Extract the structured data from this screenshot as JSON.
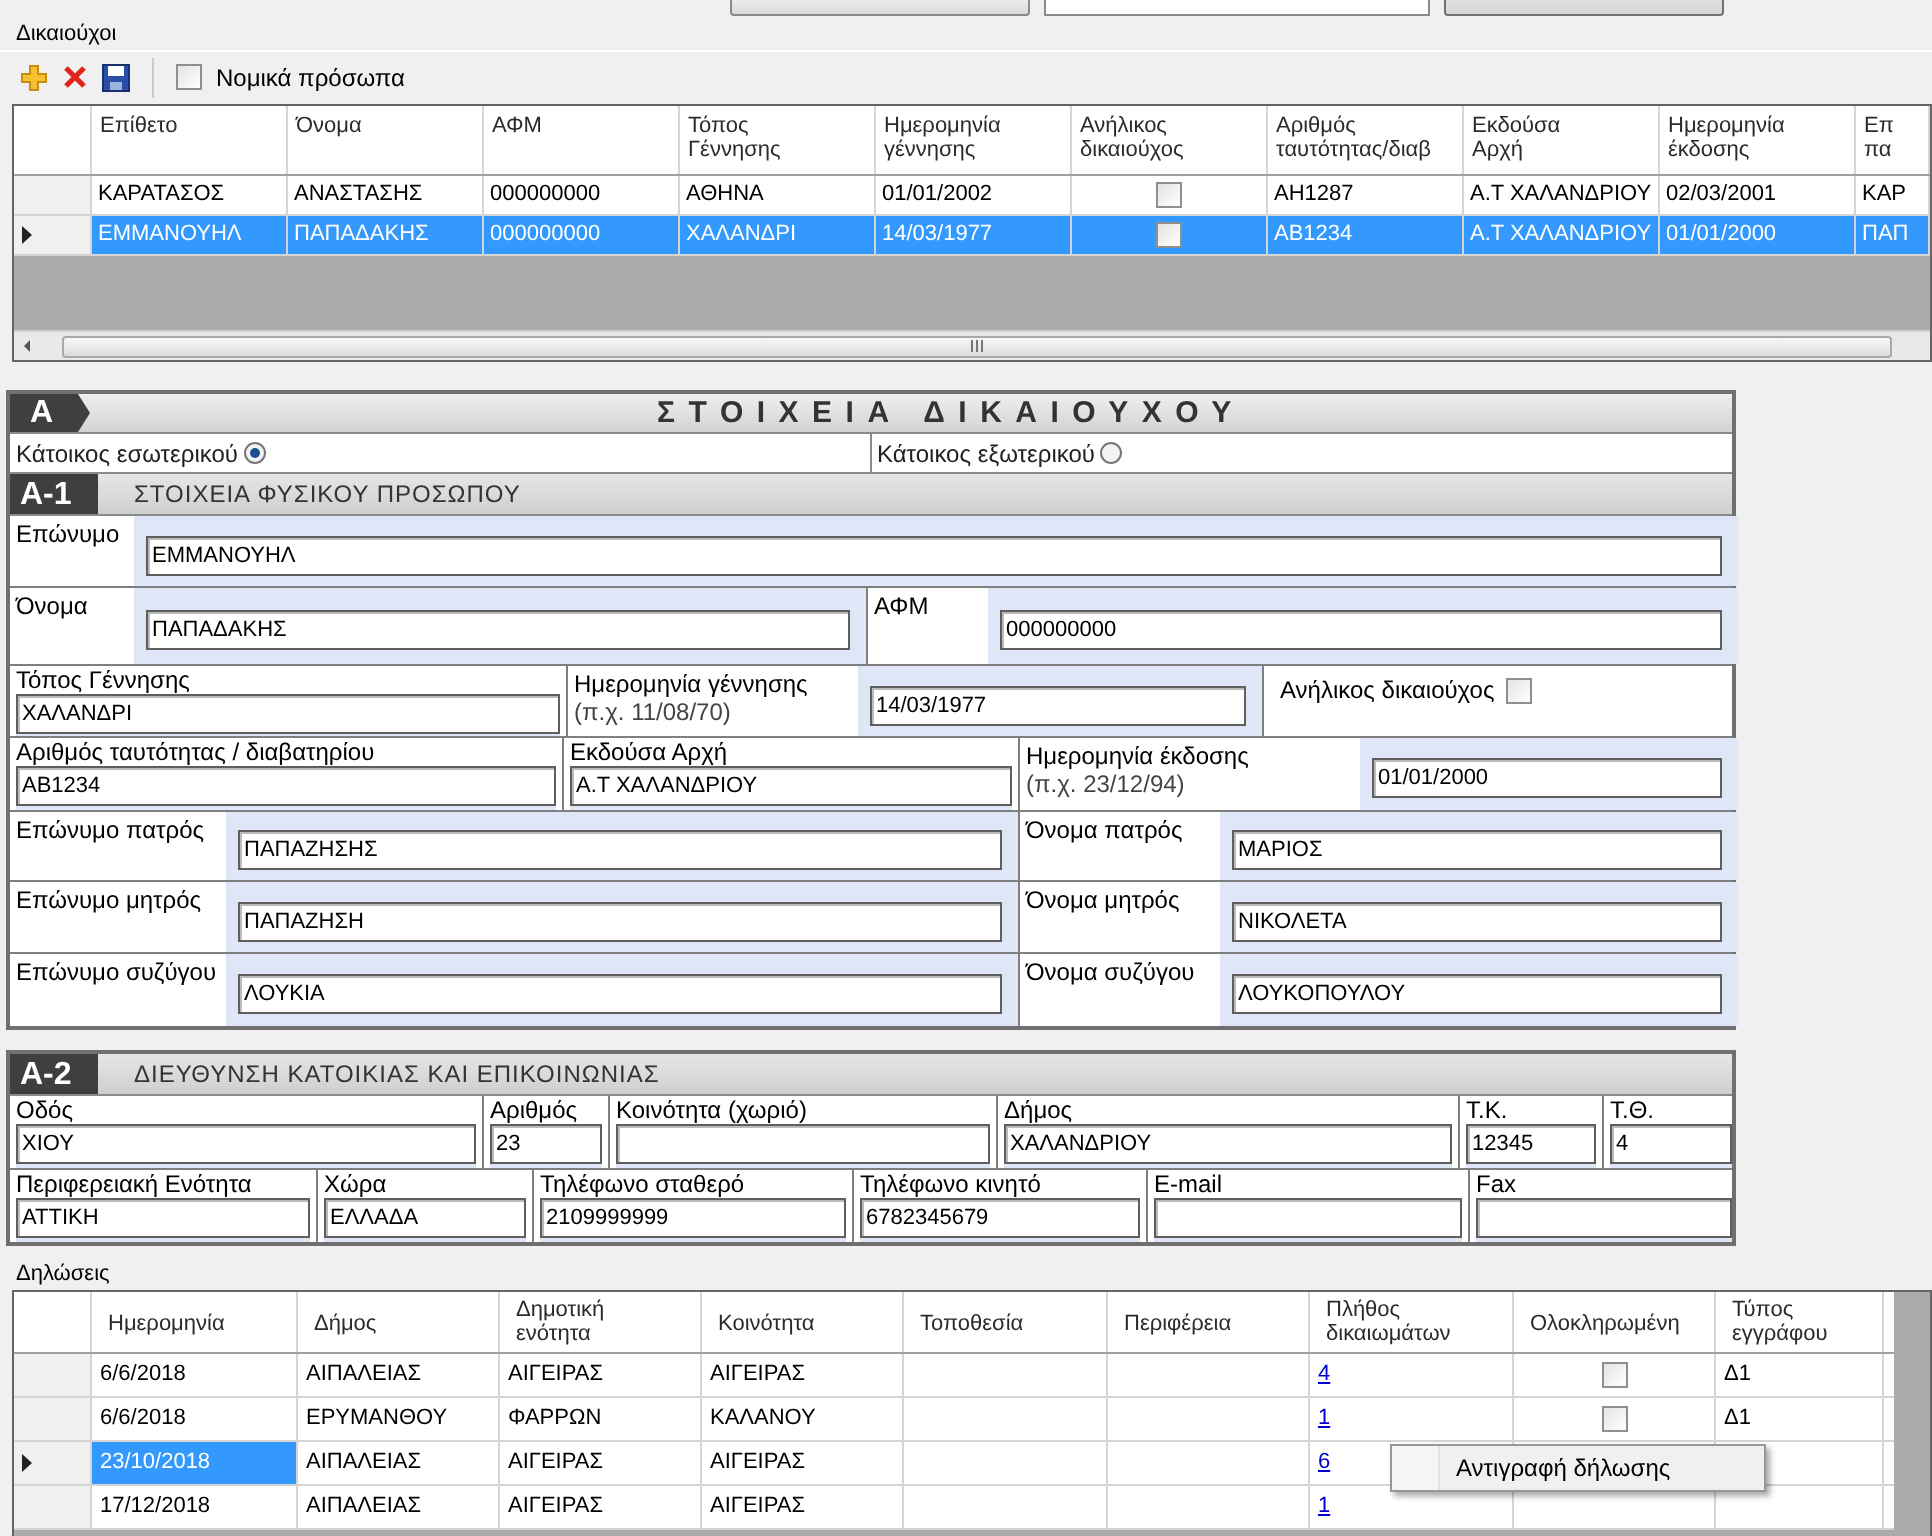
{
  "beneficiaries": {
    "title": "Δικαιούχοι",
    "toolbar": {
      "legal_entities": {
        "label": "Νομικά πρόσωπα",
        "checked": false
      }
    },
    "columns": [
      "Επίθετο",
      "Όνομα",
      "ΑΦΜ",
      "Τόπος\nΓέννησης",
      "Ημερομηνία\nγέννησης",
      "Ανήλικος\nδικαιούχος",
      "Αριθμός\nταυτότητας/διαβ",
      "Εκδούσα\nΑρχή",
      "Ημερομηνία\nέκδοσης",
      "Επ\nπα"
    ],
    "rows": [
      {
        "selected": false,
        "cells": [
          "ΚΑΡΑΤΑΣΟΣ",
          "ΑΝΑΣΤΑΣΗΣ",
          "000000000",
          "ΑΘΗΝΑ",
          "01/01/2002",
          {
            "kind": "checkbox",
            "checked": false
          },
          "ΑΗ1287",
          "Α.Τ ΧΑΛΑΝΔΡΙΟΥ",
          "02/03/2001",
          "ΚΑΡ"
        ]
      },
      {
        "selected": true,
        "cells": [
          "ΕΜΜΑΝΟΥΗΛ",
          "ΠΑΠΑΔΑΚΗΣ",
          "000000000",
          "ΧΑΛΑΝΔΡΙ",
          "14/03/1977",
          {
            "kind": "checkbox",
            "checked": false
          },
          "ΑΒ1234",
          "Α.Τ ΧΑΛΑΝΔΡΙΟΥ",
          "01/01/2000",
          "ΠΑΠ"
        ]
      }
    ]
  },
  "form": {
    "section_letter": "A",
    "title": "ΣΤΟΙΧΕΙΑ ΔΙΚΑΙΟΥΧΟΥ",
    "residence": [
      {
        "label": "Κάτοικος εσωτερικού",
        "selected": true
      },
      {
        "label": "Κάτοικος εξωτερικού",
        "selected": false
      }
    ],
    "a1": {
      "code": "A-1",
      "title": "ΣΤΟΙΧΕΙΑ ΦΥΣΙΚΟΥ ΠΡΟΣΩΠΟΥ",
      "rows": [
        [
          {
            "kind": "inline",
            "label": "Επώνυμο",
            "value": "ΕΜΜΑΝΟΥΗΛ"
          }
        ],
        [
          {
            "kind": "inline",
            "label": "Όνομα",
            "value": "ΠΑΠΑΔΑΚΗΣ"
          },
          {
            "kind": "inline",
            "label": "ΑΦΜ",
            "value": "000000000"
          }
        ],
        [
          {
            "kind": "stacked",
            "label": "Τόπος Γέννησης",
            "value": "ΧΑΛΑΝΔΡΙ"
          },
          {
            "kind": "hinted",
            "label": "Ημερομηνία γέννησης",
            "hint": "(π.χ. 11/08/70)",
            "value": "14/03/1977"
          },
          {
            "kind": "checkbox",
            "label": "Ανήλικος δικαιούχος",
            "checked": false
          }
        ],
        [
          {
            "kind": "stacked",
            "label": "Αριθμός ταυτότητας / διαβατηρίου",
            "value": "ΑΒ1234"
          },
          {
            "kind": "stacked",
            "label": "Εκδούσα Αρχή",
            "value": "Α.Τ ΧΑΛΑΝΔΡΙΟΥ"
          },
          {
            "kind": "hinted",
            "label": "Ημερομηνία έκδοσης",
            "hint": "(π.χ. 23/12/94)",
            "value": "01/01/2000"
          }
        ],
        [
          {
            "kind": "inline",
            "label": "Επώνυμο πατρός",
            "value": "ΠΑΠΑΖΗΣΗΣ"
          },
          {
            "kind": "inline",
            "label": "Όνομα πατρός",
            "value": "ΜΑΡΙΟΣ"
          }
        ],
        [
          {
            "kind": "inline",
            "label": "Επώνυμο μητρός",
            "value": "ΠΑΠΑΖΗΣΗ"
          },
          {
            "kind": "inline",
            "label": "Όνομα μητρός",
            "value": "ΝΙΚΟΛΕΤΑ"
          }
        ],
        [
          {
            "kind": "inline",
            "label": "Επώνυμο συζύγου",
            "value": "ΛΟΥΚΙΑ"
          },
          {
            "kind": "inline",
            "label": "Όνομα συζύγου",
            "value": "ΛΟΥΚΟΠΟΥΛΟΥ"
          }
        ]
      ]
    },
    "a2": {
      "code": "A-2",
      "title": "ΔΙΕΥΘΥΝΣΗ ΚΑΤΟΙΚΙΑΣ ΚΑΙ ΕΠΙΚΟΙΝΩΝΙΑΣ",
      "address_fields": [
        {
          "kind": "stacked",
          "label": "Οδός",
          "value": "ΧΙΟΥ"
        },
        {
          "kind": "stacked",
          "label": "Αριθμός",
          "value": "23"
        },
        {
          "kind": "stacked",
          "label": "Κοινότητα (χωριό)"
        },
        {
          "kind": "stacked",
          "label": "Δήμος",
          "value": "ΧΑΛΑΝΔΡΙΟΥ"
        },
        {
          "kind": "stacked",
          "label": "Τ.Κ.",
          "value": "12345"
        },
        {
          "kind": "stacked",
          "label": "Τ.Θ.",
          "value": "4"
        }
      ],
      "contact_fields": [
        {
          "kind": "stacked",
          "label": "Περιφερειακή Ενότητα",
          "value": "ΑΤΤΙΚΗ"
        },
        {
          "kind": "stacked",
          "label": "Χώρα",
          "value": "ΕΛΛΑΔΑ"
        },
        {
          "kind": "stacked",
          "label": "Τηλέφωνο σταθερό",
          "value": "2109999999"
        },
        {
          "kind": "stacked",
          "label": "Τηλέφωνο κινητό",
          "value": "6782345679"
        },
        {
          "kind": "stacked",
          "label": "E-mail"
        },
        {
          "kind": "stacked",
          "label": "Fax"
        }
      ]
    }
  },
  "declarations": {
    "title": "Δηλώσεις",
    "columns": [
      "Ημερομηνία",
      "Δήμος",
      "Δημοτική\nενότητα",
      "Κοινότητα",
      "Τοποθεσία",
      "Περιφέρεια",
      "Πλήθος\nδικαιωμάτων",
      "Ολοκληρωμένη",
      "Τύπος\nεγγράφου"
    ],
    "rows": [
      {
        "current": false,
        "cells": [
          "6/6/2018",
          "ΑΙΠΑΛΕΙΑΣ",
          "ΑΙΓΕΙΡΑΣ",
          "ΑΙΓΕΙΡΑΣ",
          null,
          null,
          {
            "kind": "link",
            "text": "4"
          },
          {
            "kind": "checkbox",
            "checked": false
          },
          "Δ1"
        ]
      },
      {
        "current": false,
        "cells": [
          "6/6/2018",
          "ΕΡΥΜΑΝΘΟΥ",
          "ΦΑΡΡΩΝ",
          "ΚΑΛΑΝΟΥ",
          null,
          null,
          {
            "kind": "link",
            "text": "1"
          },
          {
            "kind": "checkbox",
            "checked": false
          },
          "Δ1"
        ]
      },
      {
        "current": true,
        "cells": [
          "23/10/2018",
          "ΑΙΠΑΛΕΙΑΣ",
          "ΑΙΓΕΙΡΑΣ",
          "ΑΙΓΕΙΡΑΣ",
          null,
          null,
          {
            "kind": "link",
            "text": "6"
          },
          null,
          null
        ]
      },
      {
        "current": false,
        "cells": [
          "17/12/2018",
          "ΑΙΠΑΛΕΙΑΣ",
          "ΑΙΓΕΙΡΑΣ",
          "ΑΙΓΕΙΡΑΣ",
          null,
          null,
          {
            "kind": "link",
            "text": "1"
          },
          null,
          null
        ]
      }
    ]
  },
  "context_menu": {
    "items": [
      "Αντιγραφή δήλωσης"
    ]
  }
}
